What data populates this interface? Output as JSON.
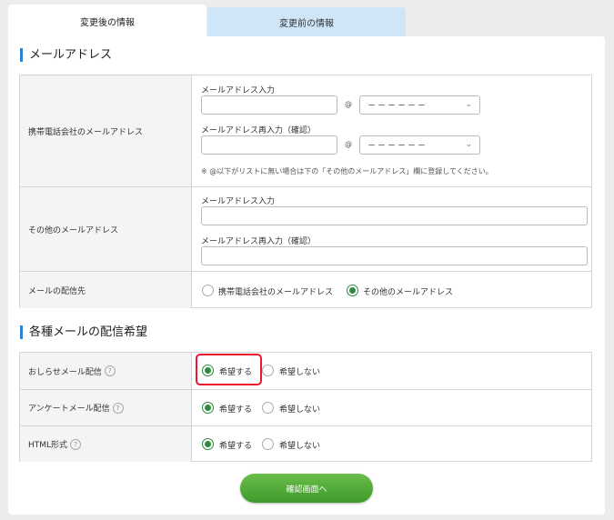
{
  "tabs": [
    {
      "label": "変更後の情報"
    },
    {
      "label": "変更前の情報"
    }
  ],
  "section_email": {
    "title": "メールアドレス",
    "rows": {
      "carrier": {
        "label": "携帯電話会社のメールアドレス",
        "input_label": "メールアドレス入力",
        "confirm_label": "メールアドレス再入力（確認）",
        "at": "@",
        "domain_selected": "－－－－－－",
        "note": "※ @以下がリストに無い場合は下の「その他のメールアドレス」欄に登録してください。"
      },
      "other": {
        "label": "その他のメールアドレス",
        "input_label": "メールアドレス入力",
        "confirm_label": "メールアドレス再入力（確認）"
      },
      "destination": {
        "label": "メールの配信先",
        "option1": "携帯電話会社のメールアドレス",
        "option2": "その他のメールアドレス"
      }
    }
  },
  "section_pref": {
    "title": "各種メールの配信希望",
    "help": "?",
    "rows": [
      {
        "label": "おしらせメール配信",
        "yes": "希望する",
        "no": "希望しない"
      },
      {
        "label": "アンケートメール配信",
        "yes": "希望する",
        "no": "希望しない"
      },
      {
        "label": "HTML形式",
        "yes": "希望する",
        "no": "希望しない"
      }
    ]
  },
  "icons": {
    "chevron": "⌄"
  },
  "submit": {
    "label": "確認画面へ"
  },
  "colors": {
    "accent": "#2c84d3",
    "radio_on": "#2e8b3c",
    "button": "#4ea535",
    "highlight": "#e8192c"
  }
}
